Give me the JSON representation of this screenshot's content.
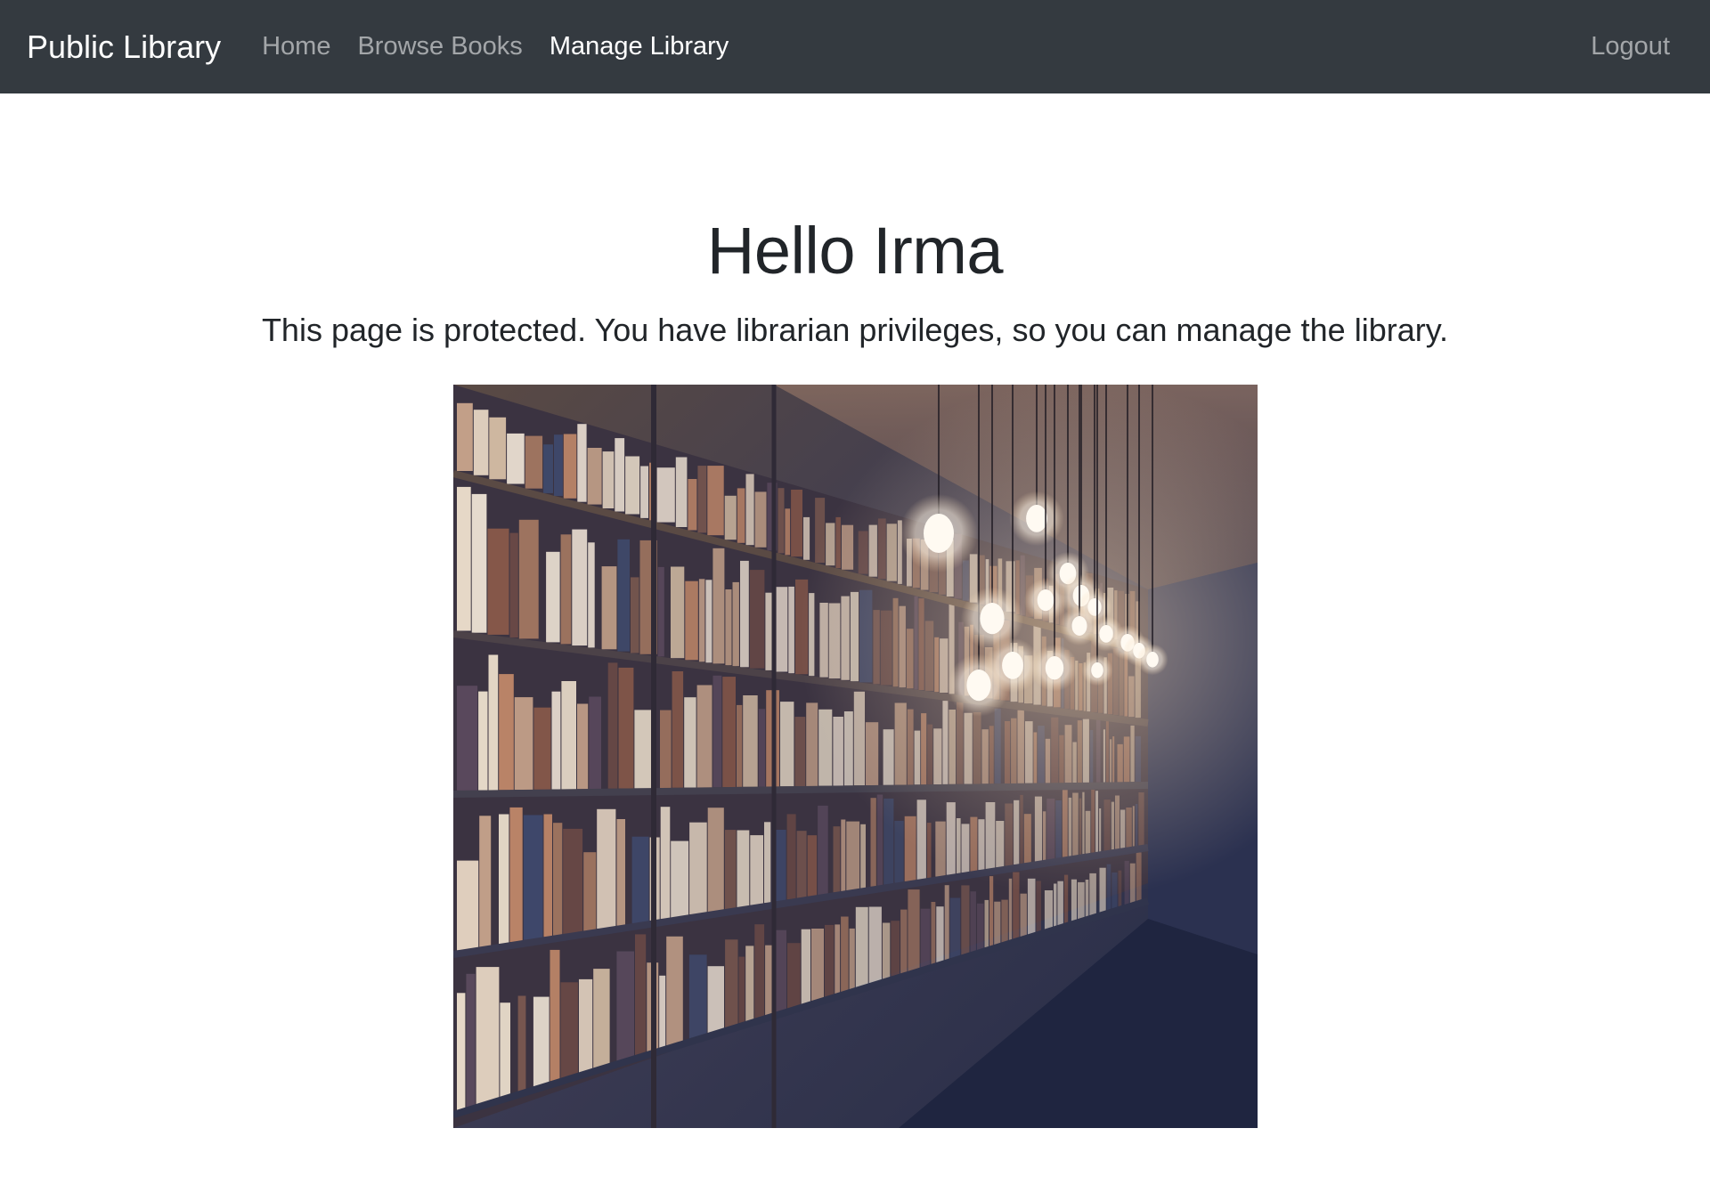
{
  "navbar": {
    "brand": "Public Library",
    "links": [
      {
        "label": "Home",
        "active": false
      },
      {
        "label": "Browse Books",
        "active": false
      },
      {
        "label": "Manage Library",
        "active": true
      }
    ],
    "logout_label": "Logout",
    "background_color": "#343a40"
  },
  "main": {
    "heading": "Hello Irma",
    "description": "This page is protected. You have librarian privileges, so you can manage the library."
  }
}
